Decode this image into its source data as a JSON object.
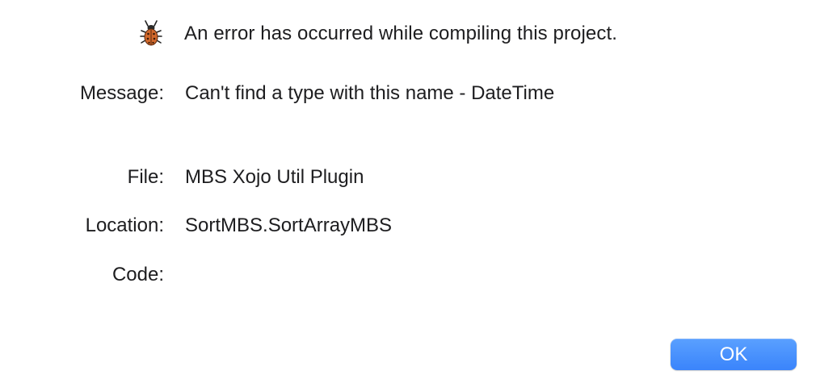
{
  "dialog": {
    "header": {
      "icon": "bug-icon",
      "text": "An error has occurred while compiling this project."
    },
    "fields": {
      "message": {
        "label": "Message:",
        "value": "Can't find a type with this name - DateTime"
      },
      "file": {
        "label": "File:",
        "value": "MBS Xojo Util Plugin"
      },
      "location": {
        "label": "Location:",
        "value": "SortMBS.SortArrayMBS"
      },
      "code": {
        "label": "Code:",
        "value": ""
      }
    },
    "ok_label": "OK",
    "accent_color": "#3a84fb"
  }
}
